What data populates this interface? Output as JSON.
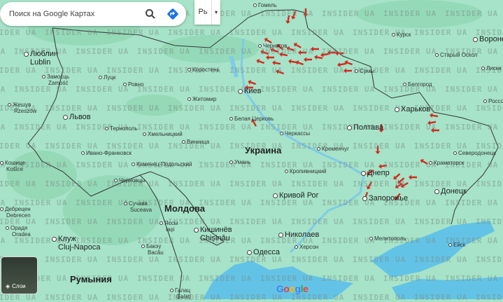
{
  "search": {
    "placeholder": "Поиск на Google Картах"
  },
  "layer_toggle": {
    "label": "Рь"
  },
  "layers_button": {
    "label": "Слои"
  },
  "google_logo": [
    "G",
    "o",
    "o",
    "g",
    "l",
    "e"
  ],
  "google_colors": [
    "#4285f4",
    "#ea4335",
    "#fbbc05",
    "#4285f4",
    "#34a853",
    "#ea4335"
  ],
  "watermark": "INSIDER UA",
  "countries": {
    "ukraine": "Украина",
    "moldova": "Молдова",
    "romania": "Румыния"
  },
  "cities": [
    {
      "id": "gomel",
      "name": "Гомель"
    },
    {
      "id": "chernigov",
      "name": "Чернигов"
    },
    {
      "id": "kursk",
      "name": "Курск"
    },
    {
      "id": "voronezh",
      "name": "Воронеж"
    },
    {
      "id": "stary-oskol",
      "name": "Старый Оскол"
    },
    {
      "id": "liski",
      "name": "Лиски"
    },
    {
      "id": "sumy",
      "name": "Сумы"
    },
    {
      "id": "belgorod",
      "name": "Белгород"
    },
    {
      "id": "kharkov",
      "name": "Харьков"
    },
    {
      "id": "rossosh",
      "name": "Россошь"
    },
    {
      "id": "poltava",
      "name": "Полтава"
    },
    {
      "id": "cherkassy",
      "name": "Черкассы"
    },
    {
      "id": "kremenchug",
      "name": "Кременчуг"
    },
    {
      "id": "severodonetsk",
      "name": "Северодонецк"
    },
    {
      "id": "kramatorsk",
      "name": "Краматорск"
    },
    {
      "id": "dnepr",
      "name": "Днепр"
    },
    {
      "id": "kropyvnytskyi",
      "name": "Кропивницкий"
    },
    {
      "id": "donetsk",
      "name": "Донецк"
    },
    {
      "id": "krivoy-rog",
      "name": "Кривой Рог"
    },
    {
      "id": "zaporozhye",
      "name": "Запорожье"
    },
    {
      "id": "nikolaev",
      "name": "Николаев"
    },
    {
      "id": "melitopol",
      "name": "Мелитополь"
    },
    {
      "id": "yeysk",
      "name": "Ейск"
    },
    {
      "id": "kherson",
      "name": "Херсон"
    },
    {
      "id": "odessa",
      "name": "Одесса"
    },
    {
      "id": "lublin",
      "name": "Люблин",
      "alt": "Lublin"
    },
    {
      "id": "zamosc",
      "name": "Замосць",
      "alt": "Zamość"
    },
    {
      "id": "lutsk",
      "name": "Луцк"
    },
    {
      "id": "rovno",
      "name": "Ровно"
    },
    {
      "id": "korosten",
      "name": "Коростень"
    },
    {
      "id": "kiev",
      "name": "Киев"
    },
    {
      "id": "zhitomir",
      "name": "Житомир"
    },
    {
      "id": "bila-tserkva",
      "name": "Белая Церковь"
    },
    {
      "id": "rzeszow",
      "name": "Жешув",
      "alt": "Rzeszów"
    },
    {
      "id": "lvov",
      "name": "Львов"
    },
    {
      "id": "ternopol",
      "name": "Тернополь"
    },
    {
      "id": "khmelnytskyi",
      "name": "Хмельницкий"
    },
    {
      "id": "vinnitsa",
      "name": "Винница"
    },
    {
      "id": "ivano-frankovsk",
      "name": "Ивано-Франковск"
    },
    {
      "id": "kamenets",
      "name": "Каменец-Подольский"
    },
    {
      "id": "uman",
      "name": "Умань"
    },
    {
      "id": "chernovtsy",
      "name": "Черновцы"
    },
    {
      "id": "suceava",
      "name": "Сучава",
      "alt": "Suceava"
    },
    {
      "id": "iasi",
      "name": "Яссы",
      "alt": "Iași"
    },
    {
      "id": "chisinau",
      "name": "Кишинёв",
      "alt": "Chișinău"
    },
    {
      "id": "debrecen",
      "name": "Дебрецен",
      "alt": "Debrecen"
    },
    {
      "id": "oradea",
      "name": "Орадя",
      "alt": "Oradea"
    },
    {
      "id": "cluj",
      "name": "Клуж",
      "alt": "Cluj-Napoca"
    },
    {
      "id": "bacau",
      "name": "Бакэу",
      "alt": "Bacău"
    },
    {
      "id": "galati",
      "name": "Галац",
      "alt": "Galați"
    },
    {
      "id": "kosice",
      "name": "Кошице",
      "alt": "Košice"
    }
  ]
}
